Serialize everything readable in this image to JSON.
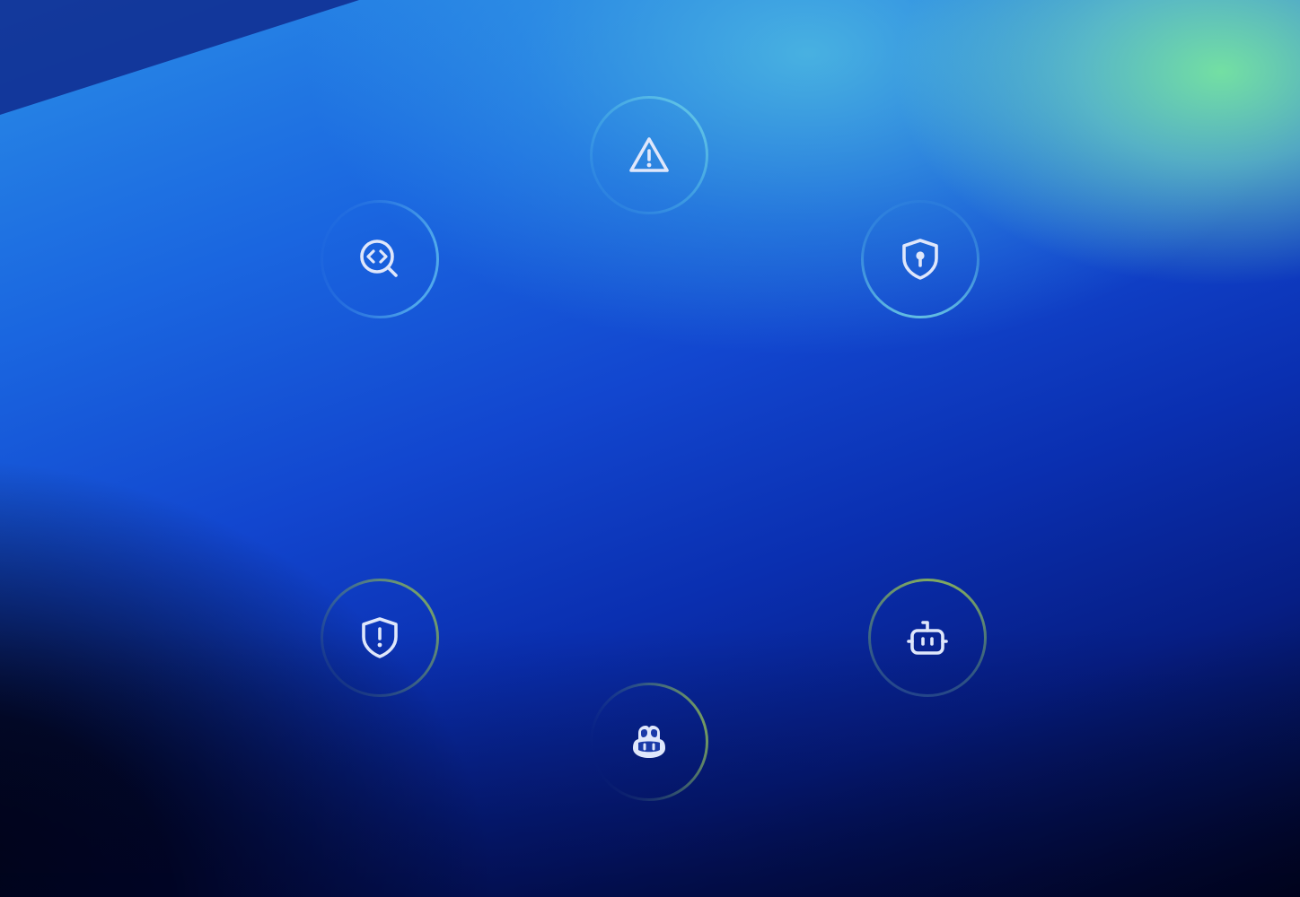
{
  "scene": {
    "background_colors": {
      "top_right_glow": "#7ddca6",
      "center_blue": "#1a66e0",
      "deep_blue": "#061e85",
      "bottom_left_dark": "#01020e"
    },
    "icon_color": "#dfe7fb",
    "ring_colors": {
      "top_rings": "#5cc8e6",
      "bottom_rings": "#7aa864"
    },
    "nodes": [
      {
        "id": "alert",
        "icon": "alert-triangle-icon"
      },
      {
        "id": "code-scan",
        "icon": "code-search-icon"
      },
      {
        "id": "secret",
        "icon": "shield-lock-icon"
      },
      {
        "id": "vulnerability",
        "icon": "shield-alert-icon"
      },
      {
        "id": "bot",
        "icon": "robot-icon"
      },
      {
        "id": "copilot",
        "icon": "copilot-icon"
      }
    ]
  }
}
